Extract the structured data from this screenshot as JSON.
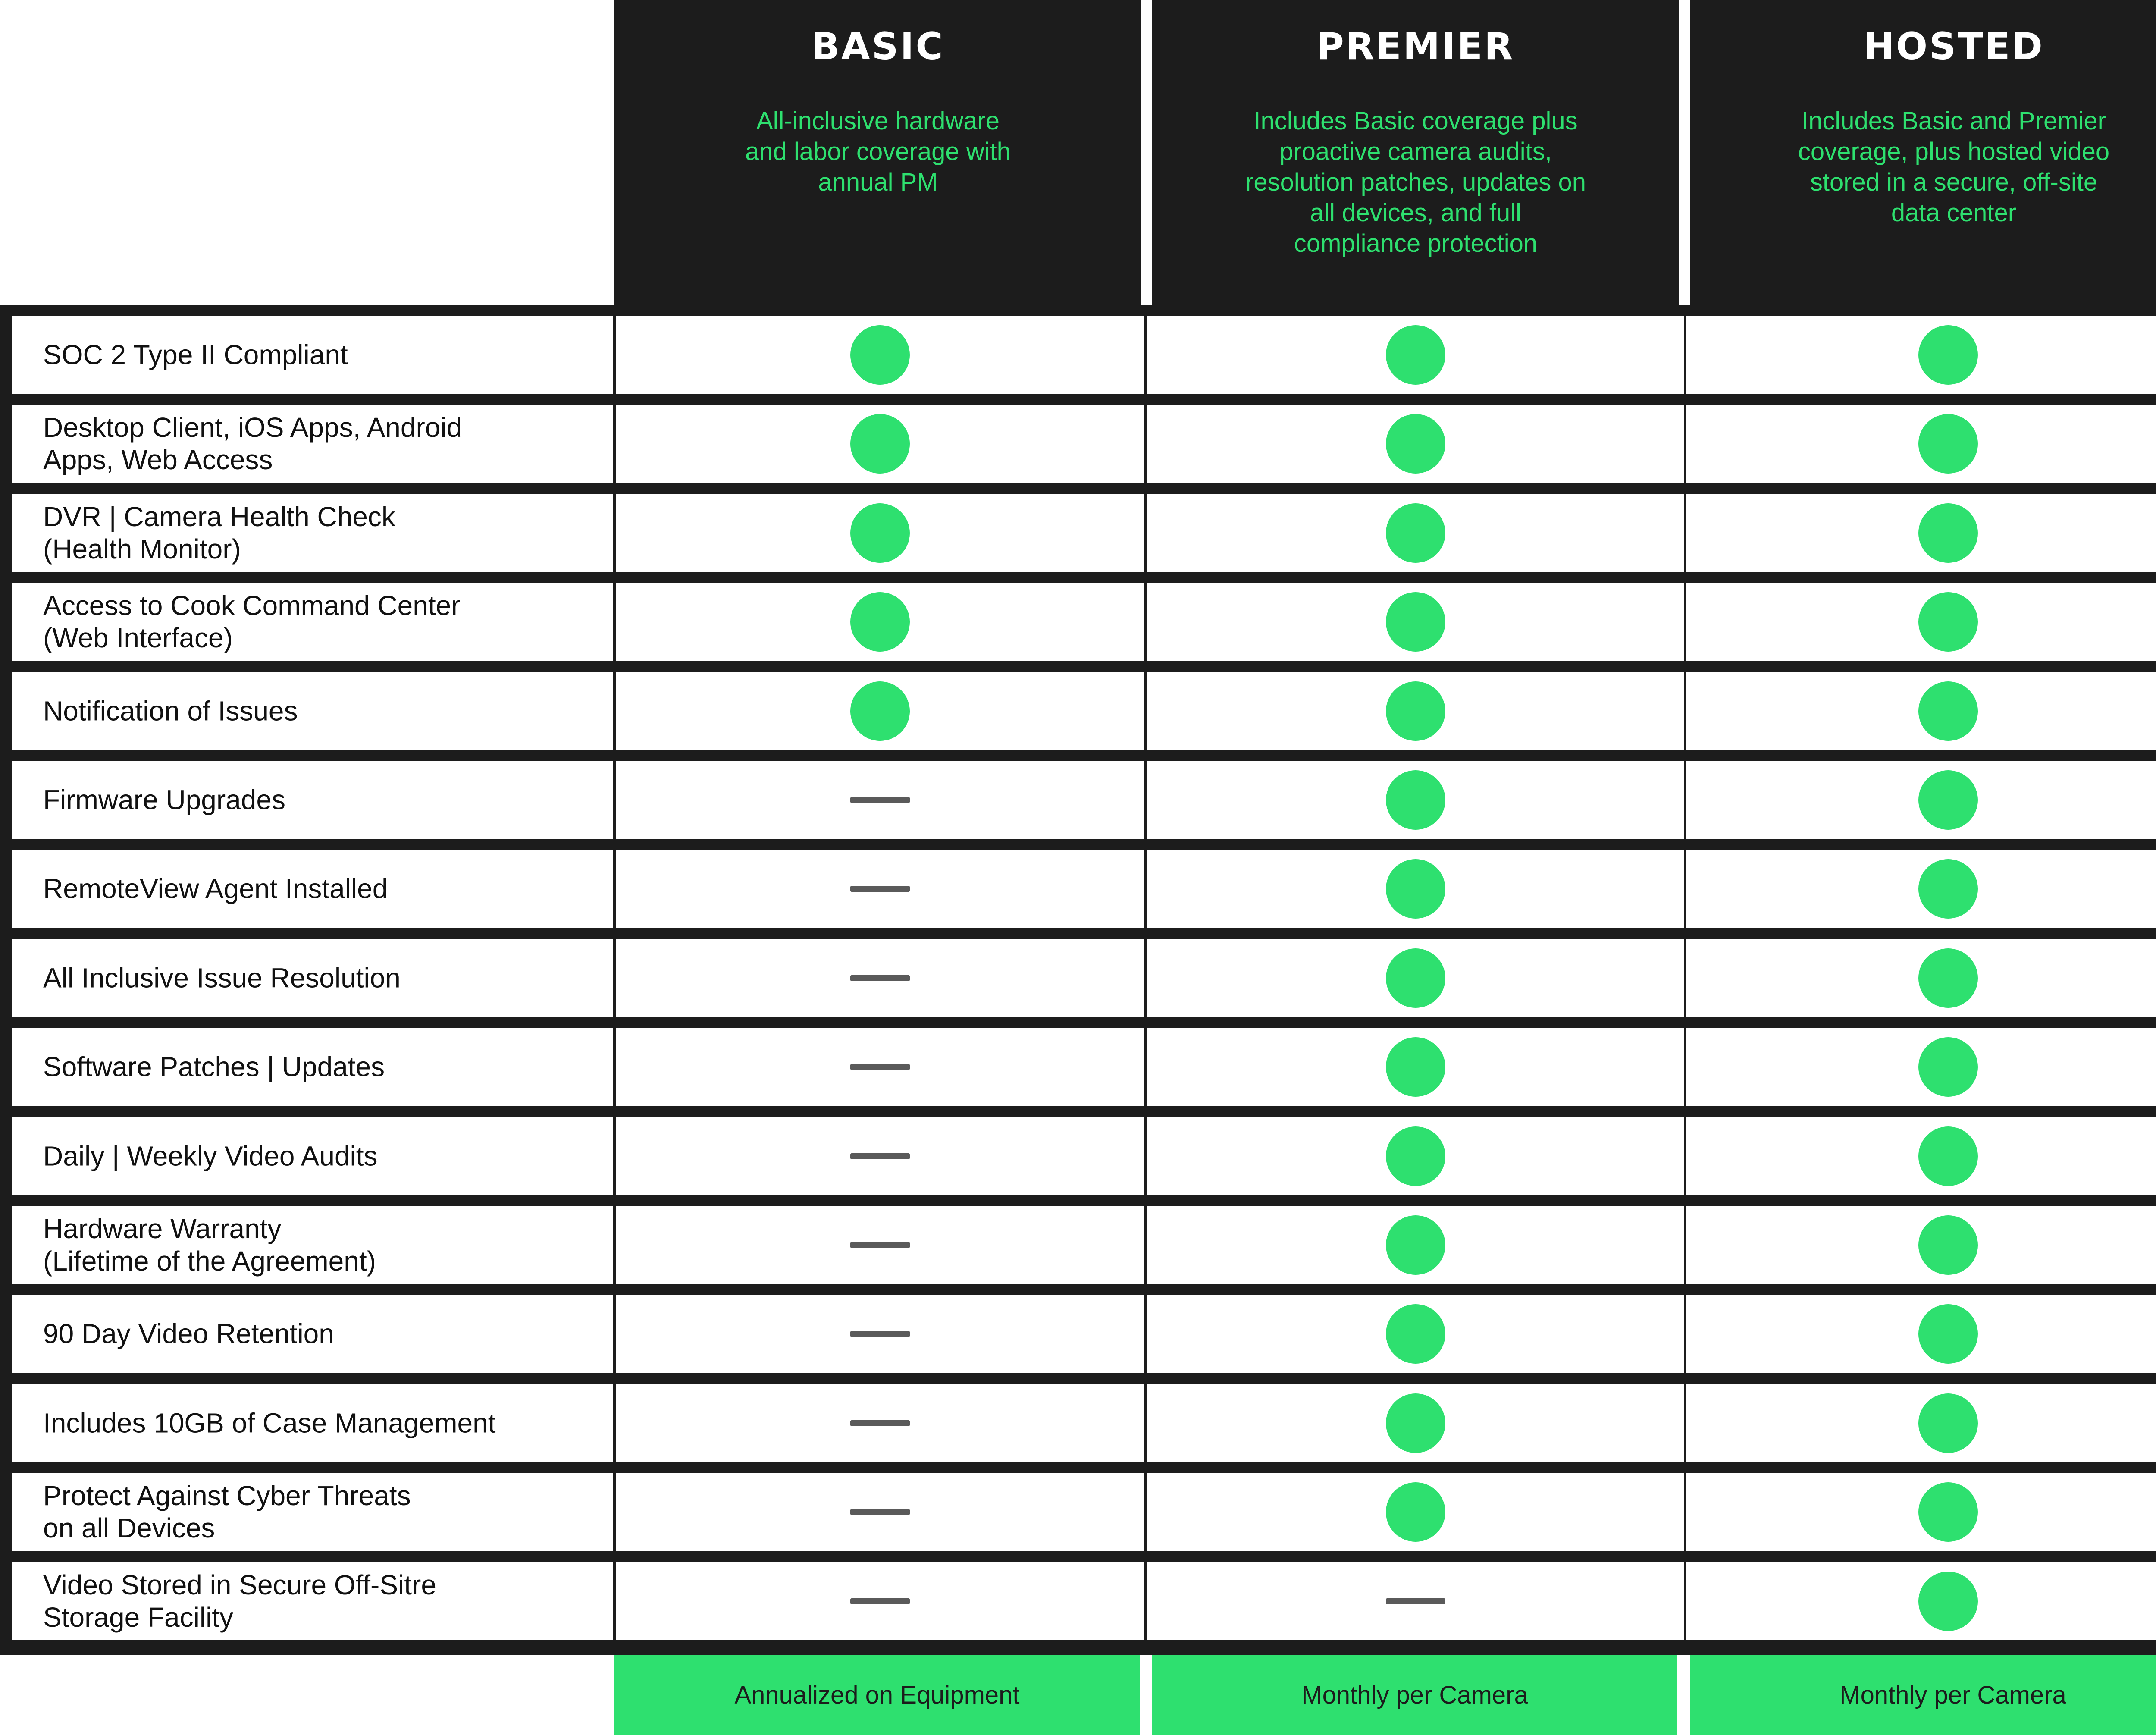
{
  "colors": {
    "header_bg": "#1c1c1c",
    "accent_green": "#2ee06f",
    "dash_gray": "#5a5a5a",
    "cell_bg": "#ffffff"
  },
  "plans": [
    {
      "name": "BASIC",
      "description": "All-inclusive hardware\nand labor coverage with\nannual PM",
      "billing": "Annualized on Equipment"
    },
    {
      "name": "PREMIER",
      "description": "Includes Basic coverage plus\nproactive camera audits,\nresolution patches, updates on\nall devices, and full\ncompliance protection",
      "billing": "Monthly per Camera"
    },
    {
      "name": "HOSTED",
      "description": "Includes Basic and Premier\ncoverage, plus hosted video\nstored in a secure, off-site\ndata center",
      "billing": "Monthly per Camera"
    }
  ],
  "features": [
    {
      "label": "SOC 2 Type II Compliant",
      "included": [
        true,
        true,
        true
      ]
    },
    {
      "label": "Desktop Client, iOS Apps, Android\nApps, Web Access",
      "included": [
        true,
        true,
        true
      ]
    },
    {
      "label": "DVR | Camera Health Check\n(Health Monitor)",
      "included": [
        true,
        true,
        true
      ]
    },
    {
      "label": "Access to Cook Command Center\n(Web Interface)",
      "included": [
        true,
        true,
        true
      ]
    },
    {
      "label": "Notification of Issues",
      "included": [
        true,
        true,
        true
      ]
    },
    {
      "label": "Firmware Upgrades",
      "included": [
        false,
        true,
        true
      ]
    },
    {
      "label": "RemoteView Agent Installed",
      "included": [
        false,
        true,
        true
      ]
    },
    {
      "label": "All Inclusive Issue Resolution",
      "included": [
        false,
        true,
        true
      ]
    },
    {
      "label": "Software Patches | Updates",
      "included": [
        false,
        true,
        true
      ]
    },
    {
      "label": "Daily | Weekly Video Audits",
      "included": [
        false,
        true,
        true
      ]
    },
    {
      "label": "Hardware Warranty\n(Lifetime of the Agreement)",
      "included": [
        false,
        true,
        true
      ]
    },
    {
      "label": "90 Day Video Retention",
      "included": [
        false,
        true,
        true
      ]
    },
    {
      "label": "Includes 10GB of Case Management",
      "included": [
        false,
        true,
        true
      ]
    },
    {
      "label": "Protect Against Cyber Threats\non all Devices",
      "included": [
        false,
        true,
        true
      ]
    },
    {
      "label": "Video Stored in Secure Off-Sitre\nStorage Facility",
      "included": [
        false,
        false,
        true
      ]
    }
  ]
}
